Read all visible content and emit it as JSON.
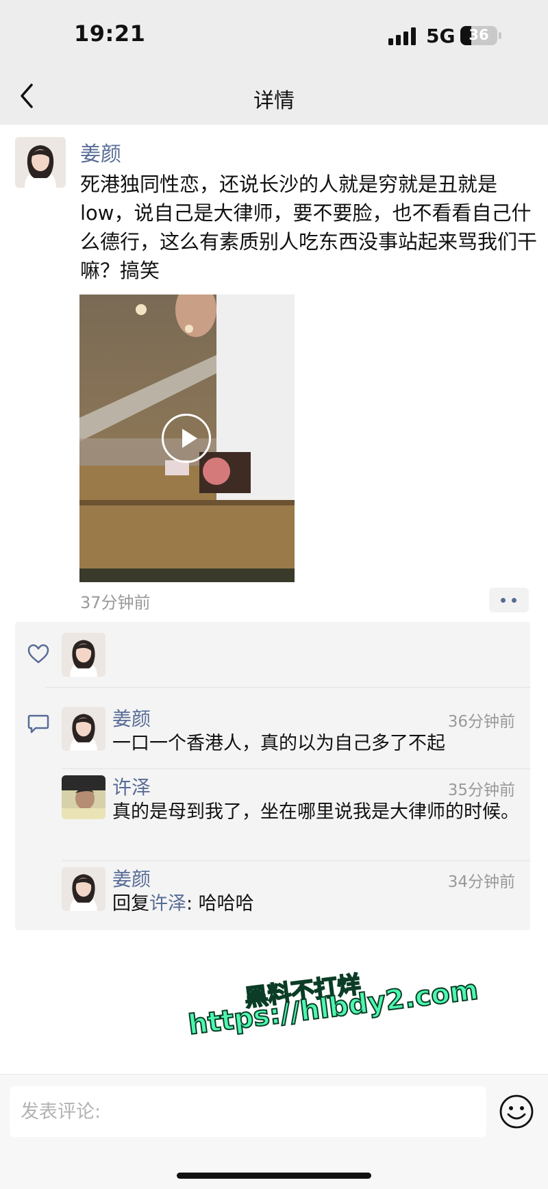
{
  "status_bar": {
    "time": "19:21",
    "network": "5G",
    "battery": "36"
  },
  "nav": {
    "title": "详情",
    "back_icon": "chevron-left-icon"
  },
  "post": {
    "author": "姜颜",
    "text": "死港独同性恋，还说长沙的人就是穷就是丑就是low，说自己是大律师，要不要脸，也不看看自己什么德行，这么有素质别人吃东西没事站起来骂我们干嘛？搞笑",
    "time": "37分钟前",
    "video_icon": "play-icon",
    "more_icon": "more-dots-icon"
  },
  "interactions": {
    "like_icon": "heart-outline-icon",
    "comment_icon": "comment-icon",
    "comments": [
      {
        "name": "姜颜",
        "time": "36分钟前",
        "text": "一口一个香港人，真的以为自己多了不起"
      },
      {
        "name": "许泽",
        "time": "35分钟前",
        "text": "真的是母到我了，坐在哪里说我是大律师的时候。"
      },
      {
        "name": "姜颜",
        "time": "34分钟前",
        "reply_prefix": "回复",
        "reply_to": "许泽",
        "text": ": 哈哈哈"
      }
    ]
  },
  "watermark": {
    "line1": "黑料不打烊",
    "line2": "https://hlbdy2.com"
  },
  "comment_bar": {
    "placeholder": "发表评论:",
    "emoji_icon": "smiley-icon"
  },
  "colors": {
    "link_blue": "#576b95",
    "header_bg": "#ededed",
    "box_bg": "#f4f4f4",
    "watermark_green": "#4df7b0"
  }
}
